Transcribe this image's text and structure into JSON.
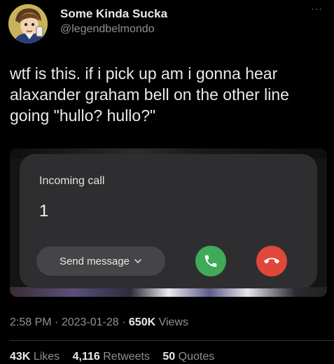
{
  "author": {
    "display_name": "Some Kinda Sucka",
    "handle": "@legendbelmondo",
    "avatar_icon": "cartoon-avatar-icon"
  },
  "menu": {
    "more_label": "···",
    "icon": "more-icon"
  },
  "tweet": {
    "text": "wtf is this. if i pick up am i gonna hear\nalaxander graham bell on the other line\ngoing \"hullo? hullo?\""
  },
  "call_screen": {
    "label": "Incoming call",
    "number": "1",
    "send_message_label": "Send message",
    "accept_icon": "phone-accept-icon",
    "decline_icon": "phone-decline-icon",
    "colors": {
      "accept": "#3faa58",
      "decline": "#e0463a",
      "card": "#2e2e30"
    }
  },
  "meta": {
    "time": "2:58 PM",
    "date": "2023-01-28",
    "views_count": "650K",
    "views_label": "Views",
    "separator": "·"
  },
  "stats": {
    "likes_count": "43K",
    "likes_label": "Likes",
    "retweets_count": "4,116",
    "retweets_label": "Retweets",
    "quotes_count": "50",
    "quotes_label": "Quotes"
  }
}
